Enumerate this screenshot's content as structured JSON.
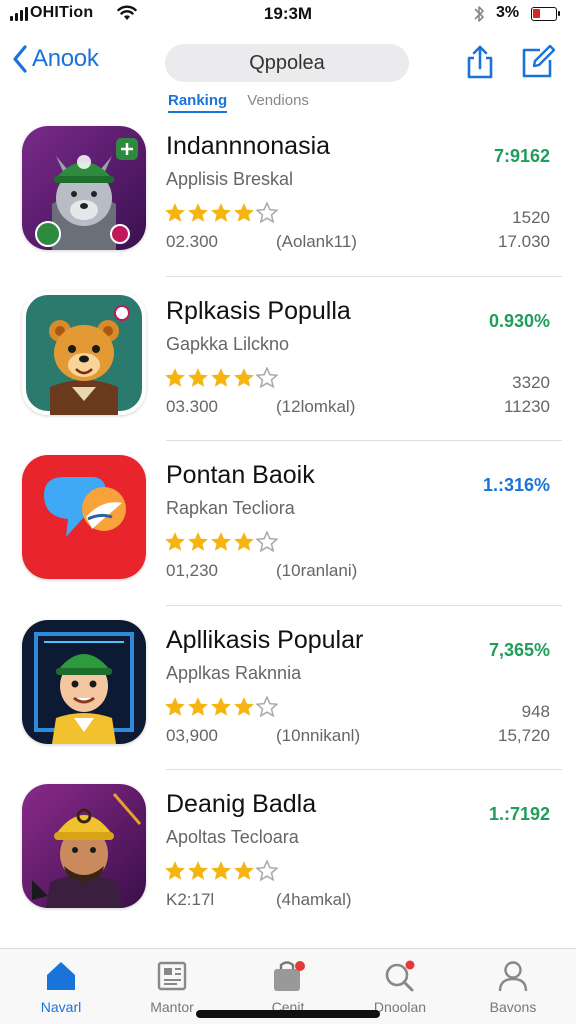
{
  "status_bar": {
    "carrier": "OHITion",
    "time": "19:3M",
    "battery_percent": "3%",
    "battery_level": 0.3,
    "battery_color": "#d62525"
  },
  "nav": {
    "back_label": "Anook",
    "search_text": "Qppolea",
    "share_icon": "share-icon",
    "compose_icon": "compose-icon"
  },
  "tabs": [
    {
      "label": "Ranking",
      "active": true
    },
    {
      "label": "Vendions",
      "active": false
    }
  ],
  "colors": {
    "accent": "#1a73d9",
    "price_green": "#1e9e5a",
    "price_blue": "#1a73d9",
    "star": "#f5b40f"
  },
  "apps": [
    {
      "title": "Indannnonasia",
      "subtitle": "Applisis Breskal",
      "rating": 4,
      "meta_left": "02.300",
      "meta_mid": "(Aolank11)",
      "price": "7:9162",
      "price_color": "#1e9e5a",
      "count_top": "1520",
      "count_bottom": "17.030",
      "icon": "wolf-cap-icon"
    },
    {
      "title": "Rplkasis Populla",
      "subtitle": "Gapkka Lilckno",
      "rating": 4,
      "meta_left": "03.300",
      "meta_mid": "(12lomkal)",
      "price": "0.930%",
      "price_color": "#1e9e5a",
      "count_top": "3320",
      "count_bottom": "11230",
      "icon": "bear-mascot-icon"
    },
    {
      "title": "Pontan Baoik",
      "subtitle": "Rapkan Tecliora",
      "rating": 4,
      "meta_left": "01,230",
      "meta_mid": "(10ranlani)",
      "price": "1.:316%",
      "price_color": "#1a73d9",
      "count_top": "",
      "count_bottom": "",
      "icon": "chat-bubble-icon"
    },
    {
      "title": "Apllikasis Popular",
      "subtitle": "Applkas Raknnia",
      "rating": 4,
      "meta_left": "03,900",
      "meta_mid": "(10nnikanl)",
      "price": "7,365%",
      "price_color": "#1e9e5a",
      "count_top": "948",
      "count_bottom": "15,720",
      "icon": "cartoon-character-icon"
    },
    {
      "title": "Deanig Badla",
      "subtitle": "Apoltas Tecloara",
      "rating": 4,
      "meta_left": "K2:17l",
      "meta_mid": "(4hamkal)",
      "price": "1.:7192",
      "price_color": "#1e9e5a",
      "count_top": "",
      "count_bottom": "",
      "icon": "hero-portrait-icon"
    }
  ],
  "tab_bar": [
    {
      "label": "Navarl",
      "icon": "home-icon",
      "active": true
    },
    {
      "label": "Mantor",
      "icon": "news-icon",
      "active": false
    },
    {
      "label": "Cenit",
      "icon": "bag-icon",
      "active": false
    },
    {
      "label": "Dnoolan",
      "icon": "search-icon",
      "active": false
    },
    {
      "label": "Bavons",
      "icon": "person-icon",
      "active": false
    }
  ]
}
